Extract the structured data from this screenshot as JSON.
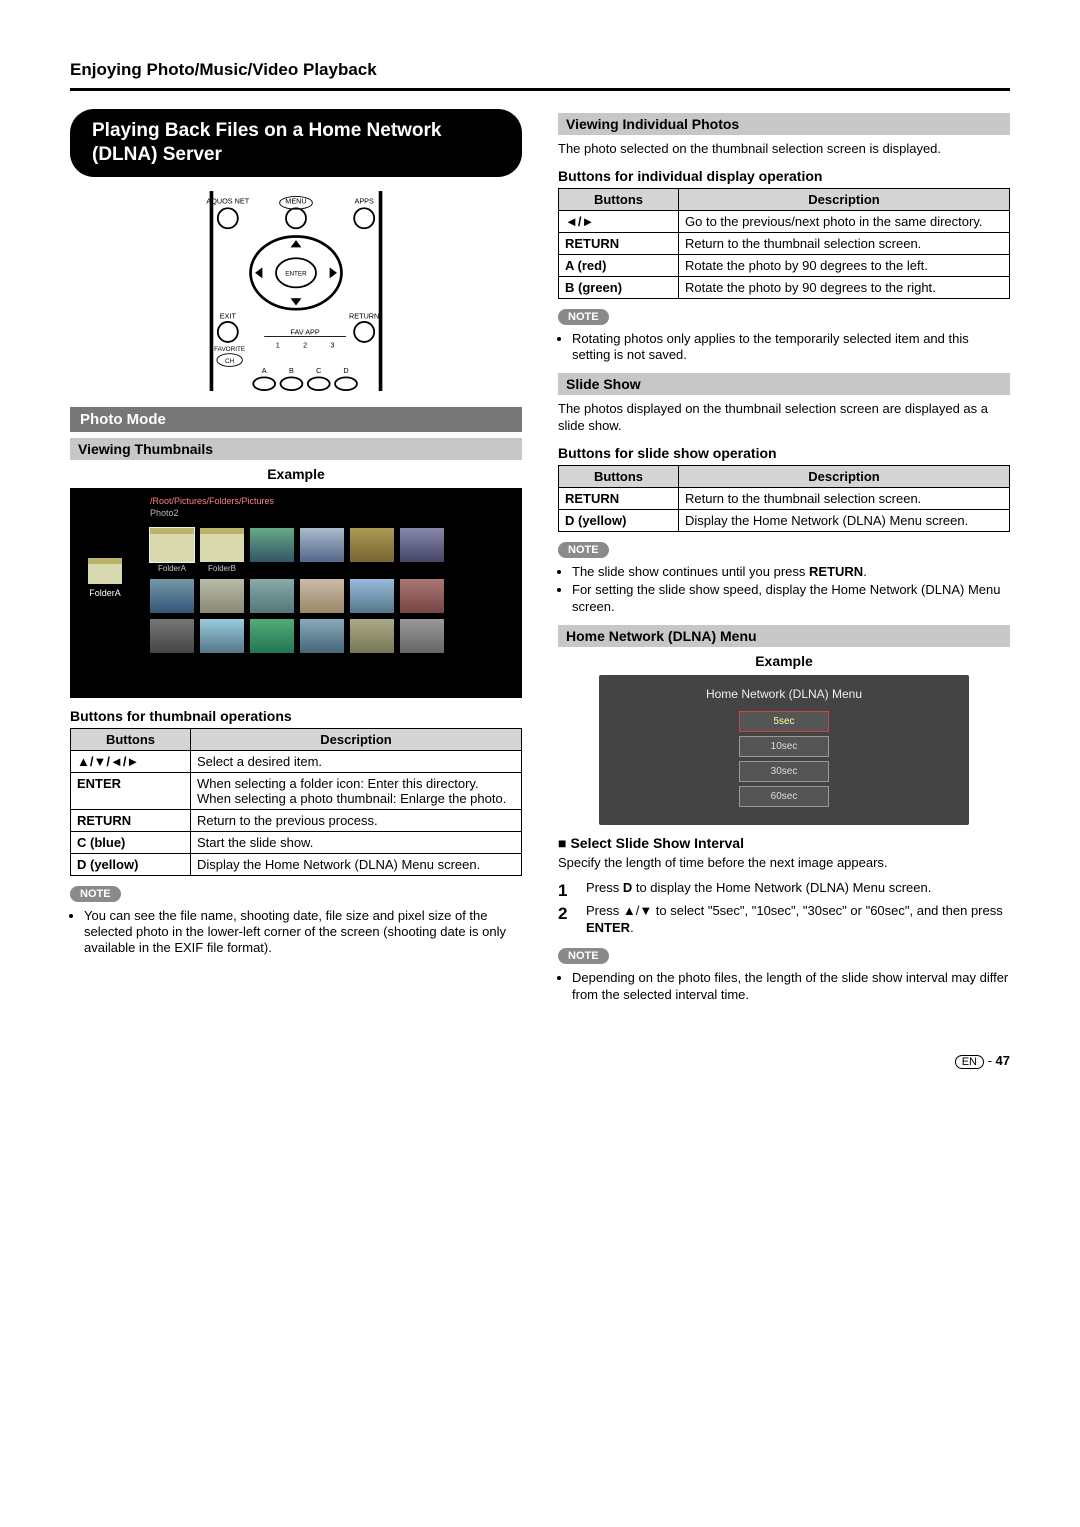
{
  "chapterTitle": "Enjoying Photo/Music/Video Playback",
  "mainHeading": "Playing Back Files on a Home Network (DLNA) Server",
  "remote": {
    "aquosNet": "AQUOS NET",
    "menu": "MENU",
    "apps": "APPS",
    "enter": "ENTER",
    "exit": "EXIT",
    "return": "RETURN",
    "favApp": "FAV APP",
    "favorite": "FAVORITE",
    "ch": "CH",
    "one": "1",
    "two": "2",
    "three": "3",
    "a": "A",
    "b": "B",
    "c": "C",
    "d": "D"
  },
  "photoModeHeading": "Photo Mode",
  "viewingThumbnailsHeading": "Viewing Thumbnails",
  "exampleLabel": "Example",
  "thumbScreen": {
    "path": "/Root/Pictures/Folders/Pictures",
    "current": "Photo2",
    "leftFolder": "FolderA",
    "folderA": "FolderA",
    "folderB": "FolderB"
  },
  "thumbOpsTitle": "Buttons for thumbnail operations",
  "tableHeaders": {
    "buttons": "Buttons",
    "description": "Description"
  },
  "thumbOps": [
    {
      "btn": "▲/▼/◄/►",
      "desc": "Select a desired item."
    },
    {
      "btn": "ENTER",
      "desc": "When selecting a folder icon: Enter this directory.\nWhen selecting a photo thumbnail: Enlarge the photo."
    },
    {
      "btn": "RETURN",
      "desc": "Return to the previous process."
    },
    {
      "btn": "C (blue)",
      "desc": "Start the slide show."
    },
    {
      "btn": "D (yellow)",
      "desc": "Display the Home Network (DLNA) Menu screen."
    }
  ],
  "noteLabel": "NOTE",
  "thumbNote": "You can see the file name, shooting date, file size and pixel size of the selected photo in the lower-left corner of the screen (shooting date is only available in the EXIF file format).",
  "viewingIndividualHeading": "Viewing Individual Photos",
  "viewingIndividualBody": "The photo selected on the thumbnail selection screen is displayed.",
  "individualOpsTitle": "Buttons for individual display operation",
  "individualOps": [
    {
      "btn": "◄/►",
      "desc": "Go to the previous/next photo in the same directory."
    },
    {
      "btn": "RETURN",
      "desc": "Return to the thumbnail selection screen."
    },
    {
      "btn": "A (red)",
      "desc": "Rotate the photo by 90 degrees to the left."
    },
    {
      "btn": "B (green)",
      "desc": "Rotate the photo by 90 degrees to the right."
    }
  ],
  "individualNote": "Rotating photos only applies to the temporarily selected item and this setting is not saved.",
  "slideShowHeading": "Slide Show",
  "slideShowBody": "The photos displayed on the thumbnail selection screen are displayed as a slide show.",
  "slideOpsTitle": "Buttons for slide show operation",
  "slideOps": [
    {
      "btn": "RETURN",
      "desc": "Return to the thumbnail selection screen."
    },
    {
      "btn": "D (yellow)",
      "desc": "Display the Home Network (DLNA) Menu screen."
    }
  ],
  "slideNote1": "The slide show continues until you press ",
  "slideNote1b": "RETURN",
  "slideNote1c": ".",
  "slideNote2": "For setting the slide show speed, display the Home Network (DLNA) Menu screen.",
  "dlnaMenuHeading": "Home Network (DLNA) Menu",
  "dlnaMenuFig": {
    "title": "Home Network (DLNA) Menu",
    "opts": [
      "5sec",
      "10sec",
      "30sec",
      "60sec"
    ]
  },
  "selectIntervalHeading": "Select Slide Show Interval",
  "selectIntervalBody": "Specify the length of time before the next image appears.",
  "step1a": "Press ",
  "step1b": "D",
  "step1c": " to display the Home Network (DLNA) Menu screen.",
  "step2a": "Press ▲/▼ to select \"5sec\", \"10sec\", \"30sec\" or \"60sec\", and then press ",
  "step2b": "ENTER",
  "step2c": ".",
  "intervalNote": "Depending on the photo files, the length of the slide show interval may differ from the selected interval time.",
  "footer": {
    "en": "EN",
    "sep": " - ",
    "page": "47"
  }
}
